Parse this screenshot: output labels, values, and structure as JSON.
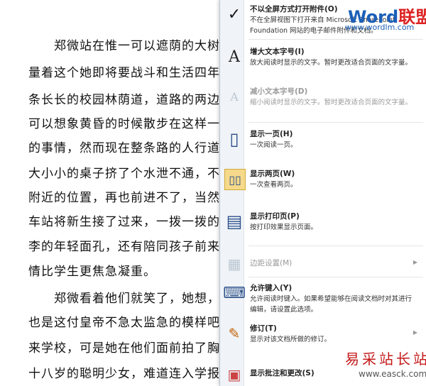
{
  "document": {
    "lines": [
      "　　郑微站在惟一可以遮荫的大树",
      "量着这个她即将要战斗和生活四年",
      "条长长的校园林荫道，道路的两边",
      "可以想象黄昏的时候散步在这样一",
      "的事情，然而现在整条路的人行道",
      "大小小的桌子挤了个水泄不通，不",
      "附近的位置，再也前进不了，当然",
      "车站将新生接了过来，一拨一拨的",
      "李的年轻面孔，还有陪同孩子前来",
      "情比学生更焦急凝重。",
      "　　郑微看着他们就笑了，她想，",
      "也是这付皇帝不急太监急的模样吧",
      "来学校，可是她在他们面前拍了胸",
      "十八岁的聪明少女，难道连入学报"
    ]
  },
  "menu": {
    "items": [
      {
        "icon": "checkmark-icon",
        "glyph": "✓",
        "title": "不以全屏方式打开附件(O)",
        "desc": "不在全屏视图下打开来自 Microsoft SharePoint Foundation 网站的电子邮件附件和文档。",
        "disabled": false
      },
      {
        "icon": "increase-text-size-icon",
        "glyph": "A",
        "title": "增大文本字号(I)",
        "desc": "放大阅读时显示的文字。暂时更改适合页面的文字量。",
        "disabled": false
      },
      {
        "icon": "decrease-text-size-icon",
        "glyph": "A",
        "title": "减小文本字号(D)",
        "desc": "缩小阅读时显示的文字。暂时更改适合页面的文字量。",
        "disabled": true
      },
      {
        "icon": "one-page-icon",
        "glyph": "▯",
        "title": "显示一页(H)",
        "desc": "一次阅读一页。",
        "disabled": false
      },
      {
        "icon": "two-pages-icon",
        "glyph": "▯▯",
        "title": "显示两页(W)",
        "desc": "一次查看两页。",
        "disabled": false
      },
      {
        "icon": "print-page-icon",
        "glyph": "▤",
        "title": "显示打印页(P)",
        "desc": "按打印效果显示页面。",
        "disabled": false
      },
      {
        "icon": "margin-settings-icon",
        "glyph": "▦",
        "title": "边距设置(M)",
        "desc": "",
        "disabled": true
      },
      {
        "icon": "allow-typing-icon",
        "glyph": "⌨",
        "title": "允许键入(Y)",
        "desc": "允许阅读时键入。如果希望能够在阅读文档时对其进行编辑，请设置此选项。",
        "disabled": false
      },
      {
        "icon": "track-changes-icon",
        "glyph": "✎",
        "title": "修订(T)",
        "desc": "显示对该文档所做的修订。",
        "disabled": false
      },
      {
        "icon": "show-comments-icon",
        "glyph": "▣",
        "title": "显示批注和更改(S)",
        "desc": "",
        "disabled": false
      }
    ]
  },
  "watermarks": {
    "word_blue": "Word",
    "word_red": "联盟",
    "word_url": "www.wordlm.com",
    "site_name": "易采站长站",
    "site_url": "www.easck.com"
  }
}
